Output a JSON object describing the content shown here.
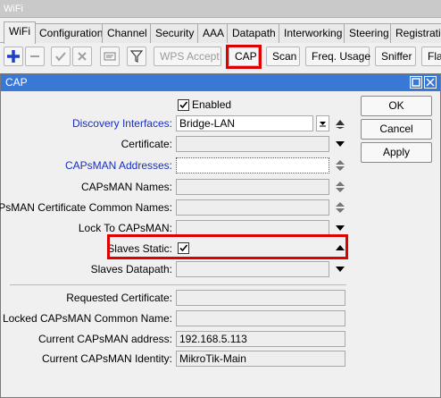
{
  "window": {
    "title": "WiFi"
  },
  "tabs": [
    "WiFi",
    "Configuration",
    "Channel",
    "Security",
    "AAA",
    "Datapath",
    "Interworking",
    "Steering",
    "Registration"
  ],
  "toolbar": {
    "icons": [
      "plus-icon",
      "minus-icon",
      "check-icon",
      "cross-icon",
      "comment-icon",
      "filter-icon"
    ],
    "buttons": [
      "WPS Accept",
      "CAP",
      "Scan",
      "Freq. Usage",
      "Sniffer",
      "Flat"
    ]
  },
  "dialog": {
    "title": "CAP",
    "enabled_label": "Enabled",
    "buttons": {
      "ok": "OK",
      "cancel": "Cancel",
      "apply": "Apply"
    },
    "fields": {
      "discovery_interfaces": {
        "label": "Discovery Interfaces:",
        "value": "Bridge-LAN"
      },
      "certificate": {
        "label": "Certificate:",
        "value": ""
      },
      "capsman_addresses": {
        "label": "CAPsMAN Addresses:",
        "value": ""
      },
      "capsman_names": {
        "label": "CAPsMAN Names:",
        "value": ""
      },
      "capsman_cert_names": {
        "label": "CAPsMAN Certificate Common Names:",
        "value": ""
      },
      "lock_to_capsman": {
        "label": "Lock To CAPsMAN:",
        "value": ""
      },
      "slaves_static": {
        "label": "Slaves Static:"
      },
      "slaves_datapath": {
        "label": "Slaves Datapath:",
        "value": ""
      }
    },
    "status": {
      "requested_certificate": {
        "label": "Requested Certificate:",
        "value": ""
      },
      "locked_capsman_common_name": {
        "label": "Locked CAPsMAN Common Name:",
        "value": ""
      },
      "current_capsman_address": {
        "label": "Current CAPsMAN address:",
        "value": "192.168.5.113"
      },
      "current_capsman_identity": {
        "label": "Current CAPsMAN Identity:",
        "value": "MikroTik-Main"
      }
    }
  },
  "colors": {
    "highlight": "#e00000",
    "dialog_title": "#3a78d6",
    "link_label": "#1a2fbd"
  }
}
